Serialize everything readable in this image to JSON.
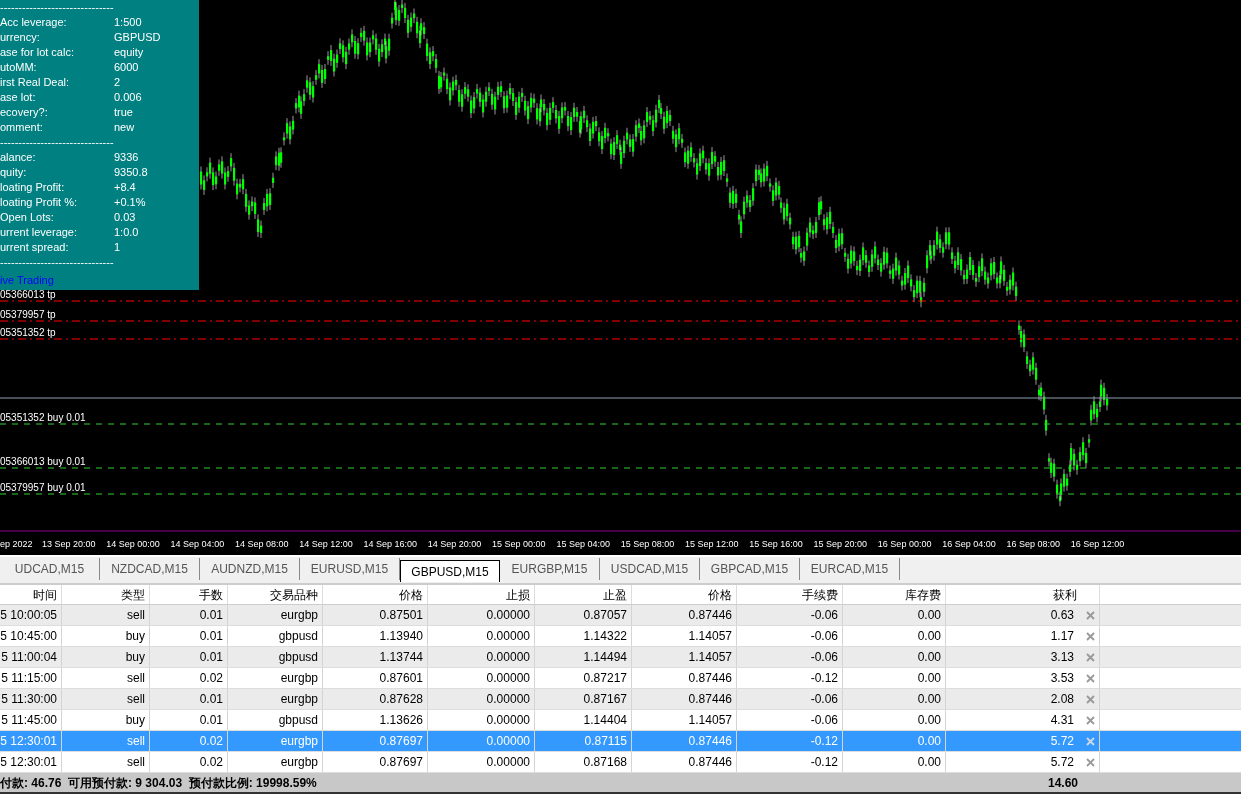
{
  "info_panel": {
    "items": [
      {
        "kind": "rule",
        "text": "-------------------------------"
      },
      {
        "kind": "row",
        "label": "Acc leverage:",
        "value": "1:500"
      },
      {
        "kind": "row",
        "label": "urrency:",
        "value": "GBPUSD"
      },
      {
        "kind": "row",
        "label": "ase for lot calc:",
        "value": "equity"
      },
      {
        "kind": "row",
        "label": "utoMM:",
        "value": "6000"
      },
      {
        "kind": "row",
        "label": "irst Real Deal:",
        "value": "2"
      },
      {
        "kind": "row",
        "label": "ase lot:",
        "value": "0.006"
      },
      {
        "kind": "row",
        "label": "ecovery?:",
        "value": "true"
      },
      {
        "kind": "row",
        "label": "omment:",
        "value": "new"
      },
      {
        "kind": "rule",
        "text": "-------------------------------"
      },
      {
        "kind": "row",
        "label": "alance:",
        "value": "9336"
      },
      {
        "kind": "row",
        "label": "quity:",
        "value": "9350.8"
      },
      {
        "kind": "row",
        "label": "loating Profit:",
        "value": "+8.4"
      },
      {
        "kind": "row",
        "label": "loating Profit %:",
        "value": "+0.1%"
      },
      {
        "kind": "row",
        "label": "Open Lots:",
        "value": "0.03"
      },
      {
        "kind": "row",
        "label": "urrent leverage:",
        "value": "1:0.0"
      },
      {
        "kind": "row",
        "label": "urrent spread:",
        "value": "1"
      },
      {
        "kind": "rule",
        "text": "-------------------------------"
      },
      {
        "kind": "link",
        "text": "ive Trading"
      }
    ]
  },
  "chart": {
    "order_lines": [
      {
        "kind": "tp",
        "label": "05366013 tp"
      },
      {
        "kind": "tp",
        "label": "05379957 tp"
      },
      {
        "kind": "tp",
        "label": "05351352 tp"
      },
      {
        "kind": "bid"
      },
      {
        "kind": "order",
        "label": "05351352 buy 0.01"
      },
      {
        "kind": "order",
        "label": "05366013 buy 0.01"
      },
      {
        "kind": "order",
        "label": "05379957 buy 0.01"
      }
    ],
    "time_axis": [
      "ep 2022",
      "13 Sep 20:00",
      "14 Sep 00:00",
      "14 Sep 04:00",
      "14 Sep 08:00",
      "14 Sep 12:00",
      "14 Sep 16:00",
      "14 Sep 20:00",
      "15 Sep 00:00",
      "15 Sep 04:00",
      "15 Sep 08:00",
      "15 Sep 12:00",
      "15 Sep 16:00",
      "15 Sep 20:00",
      "16 Sep 00:00",
      "16 Sep 04:00",
      "16 Sep 08:00",
      "16 Sep 12:00"
    ]
  },
  "tabs": [
    {
      "label": "UDCAD,M15",
      "selected": false
    },
    {
      "label": "NZDCAD,M15",
      "selected": false
    },
    {
      "label": "AUDNZD,M15",
      "selected": false
    },
    {
      "label": "EURUSD,M15",
      "selected": false
    },
    {
      "label": "GBPUSD,M15",
      "selected": true
    },
    {
      "label": "EURGBP,M15",
      "selected": false
    },
    {
      "label": "USDCAD,M15",
      "selected": false
    },
    {
      "label": "GBPCAD,M15",
      "selected": false
    },
    {
      "label": "EURCAD,M15",
      "selected": false
    }
  ],
  "table": {
    "columns": [
      "时间",
      "类型",
      "手数",
      "交易品种",
      "价格",
      "止损",
      "止盈",
      "价格",
      "手续费",
      "库存费",
      "获利"
    ],
    "rows": [
      {
        "selected": false,
        "cells": [
          "5 10:00:05",
          "sell",
          "0.01",
          "eurgbp",
          "0.87501",
          "0.00000",
          "0.87057",
          "0.87446",
          "-0.06",
          "0.00",
          "0.63"
        ]
      },
      {
        "selected": false,
        "cells": [
          "5 10:45:00",
          "buy",
          "0.01",
          "gbpusd",
          "1.13940",
          "0.00000",
          "1.14322",
          "1.14057",
          "-0.06",
          "0.00",
          "1.17"
        ]
      },
      {
        "selected": false,
        "cells": [
          "5 11:00:04",
          "buy",
          "0.01",
          "gbpusd",
          "1.13744",
          "0.00000",
          "1.14494",
          "1.14057",
          "-0.06",
          "0.00",
          "3.13"
        ]
      },
      {
        "selected": false,
        "cells": [
          "5 11:15:00",
          "sell",
          "0.02",
          "eurgbp",
          "0.87601",
          "0.00000",
          "0.87217",
          "0.87446",
          "-0.12",
          "0.00",
          "3.53"
        ]
      },
      {
        "selected": false,
        "cells": [
          "5 11:30:00",
          "sell",
          "0.01",
          "eurgbp",
          "0.87628",
          "0.00000",
          "0.87167",
          "0.87446",
          "-0.06",
          "0.00",
          "2.08"
        ]
      },
      {
        "selected": false,
        "cells": [
          "5 11:45:00",
          "buy",
          "0.01",
          "gbpusd",
          "1.13626",
          "0.00000",
          "1.14404",
          "1.14057",
          "-0.06",
          "0.00",
          "4.31"
        ]
      },
      {
        "selected": true,
        "cells": [
          "5 12:30:01",
          "sell",
          "0.02",
          "eurgbp",
          "0.87697",
          "0.00000",
          "0.87115",
          "0.87446",
          "-0.12",
          "0.00",
          "5.72"
        ]
      },
      {
        "selected": false,
        "cells": [
          "5 12:30:01",
          "sell",
          "0.02",
          "eurgbp",
          "0.87697",
          "0.00000",
          "0.87168",
          "0.87446",
          "-0.12",
          "0.00",
          "5.72"
        ]
      }
    ]
  },
  "footer": {
    "summary": "付款: 46.76  可用预付款: 9 304.03  预付款比例: 19998.59%",
    "total_profit": "14.60"
  }
}
